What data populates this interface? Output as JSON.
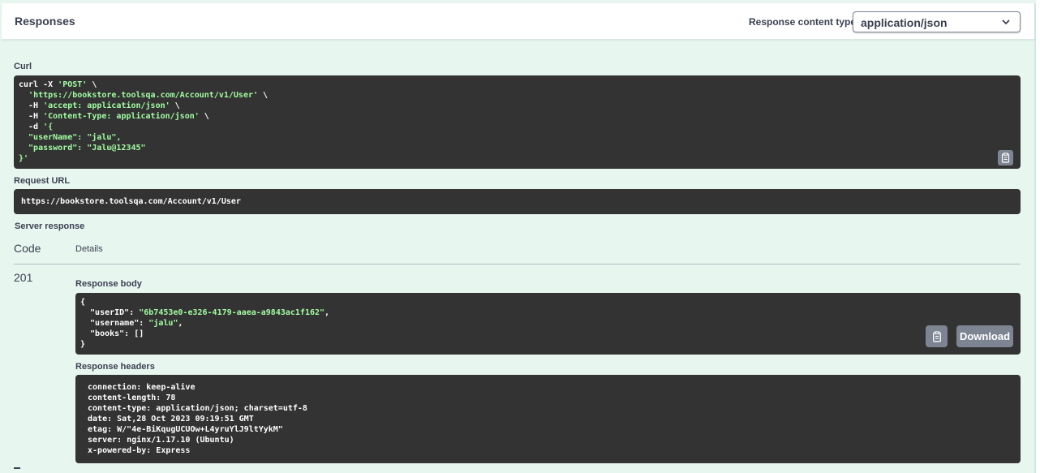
{
  "responses": {
    "title": "Responses",
    "content_type_label": "Response content type",
    "content_type_value": "application/json"
  },
  "curl": {
    "label": "Curl",
    "lines": [
      {
        "plain": "curl -X ",
        "str": "'POST'",
        "tail": " \\"
      },
      {
        "plain": "  ",
        "str": "'https://bookstore.toolsqa.com/Account/v1/User'",
        "tail": " \\"
      },
      {
        "plain": "  -H ",
        "str": "'accept: application/json'",
        "tail": " \\"
      },
      {
        "plain": "  -H ",
        "str": "'Content-Type: application/json'",
        "tail": " \\"
      },
      {
        "plain": "  -d ",
        "str": "'{",
        "tail": ""
      },
      {
        "plain": "",
        "str": "  \"userName\": \"jalu\",",
        "tail": ""
      },
      {
        "plain": "",
        "str": "  \"password\": \"Jalu@12345\"",
        "tail": ""
      },
      {
        "plain": "",
        "str": "}'",
        "tail": ""
      }
    ]
  },
  "request_url": {
    "label": "Request URL",
    "value": "https://bookstore.toolsqa.com/Account/v1/User"
  },
  "server_response": {
    "label": "Server response",
    "col_code": "Code",
    "col_details": "Details",
    "code": "201",
    "body_label": "Response body",
    "body_lines": [
      {
        "key": "{",
        "val": "",
        "tail": ""
      },
      {
        "key": "  \"userID\": ",
        "val": "\"6b7453e0-e326-4179-aaea-a9843ac1f162\"",
        "tail": ","
      },
      {
        "key": "  \"username\": ",
        "val": "\"jalu\"",
        "tail": ","
      },
      {
        "key": "  \"books\": ",
        "val": "",
        "tail": "[]"
      },
      {
        "key": "}",
        "val": "",
        "tail": ""
      }
    ],
    "download_label": "Download",
    "headers_label": "Response headers",
    "headers": [
      " connection: keep-alive ",
      " content-length: 78 ",
      " content-type: application/json; charset=utf-8 ",
      " date: Sat,28 Oct 2023 09:19:51 GMT ",
      " etag: W/\"4e-BiKqugUCUOw+L4yruYlJ9ltYykM\" ",
      " server: nginx/1.17.10 (Ubuntu) ",
      " x-powered-by: Express "
    ]
  },
  "colors": {
    "panel_bg": "#e8f6f0",
    "code_bg": "#333333",
    "string": "#a2fca2",
    "button": "#7d8492",
    "text": "#3b4151"
  },
  "icons": {
    "copy": "clipboard-icon",
    "chevron": "chevron-down-icon"
  }
}
